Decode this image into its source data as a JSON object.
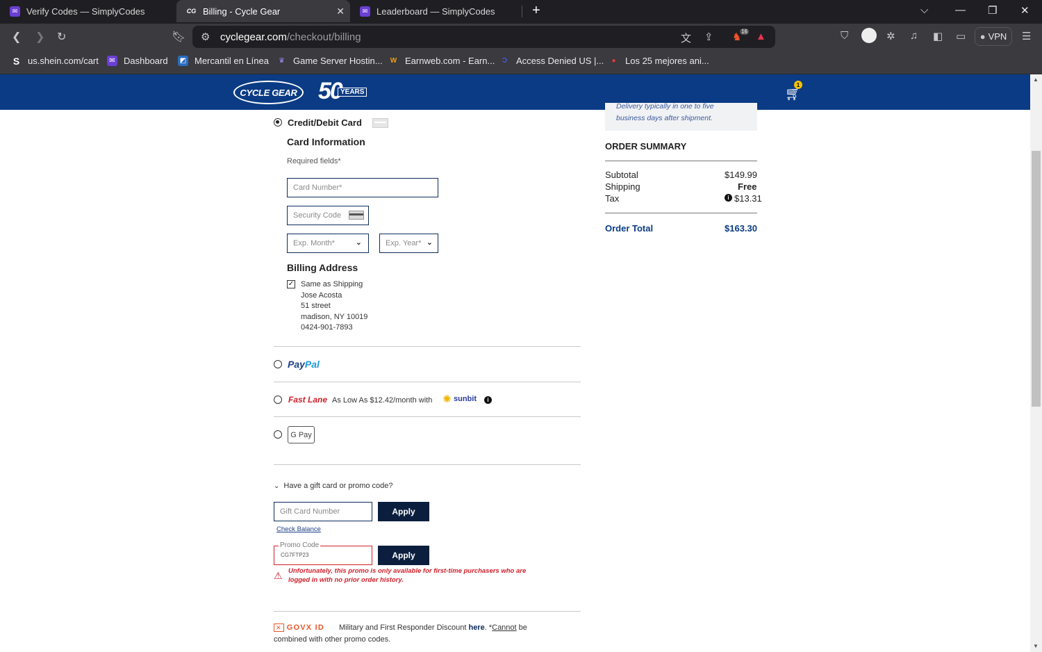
{
  "browser": {
    "tabs": [
      {
        "title": "Verify Codes — SimplyCodes",
        "favicon": "simplycodes-icon"
      },
      {
        "title": "Billing - Cycle Gear",
        "favicon": "CG"
      },
      {
        "title": "Leaderboard — SimplyCodes",
        "favicon": "simplycodes-icon"
      }
    ],
    "url_host": "cyclegear.com",
    "url_path": "/checkout/billing",
    "vpn_label": "VPN",
    "brave_badge": "16",
    "bookmarks": [
      {
        "label": "us.shein.com/cart",
        "icon": "S"
      },
      {
        "label": "Dashboard",
        "icon": "simplycodes-icon"
      },
      {
        "label": "Mercantil en Línea",
        "icon": "mercantil-icon"
      },
      {
        "label": "Game Server Hostin...",
        "icon": "game-server-icon"
      },
      {
        "label": "Earnweb.com - Earn...",
        "icon": "W"
      },
      {
        "label": "Access Denied US |...",
        "icon": "access-denied-icon"
      },
      {
        "label": "Los 25 mejores ani...",
        "icon": "pin-icon"
      }
    ]
  },
  "site": {
    "logo_text": "CYCLE GEAR",
    "anniversary_number": "50",
    "anniversary_word": "YEARS",
    "cart_count": "1"
  },
  "payment": {
    "credit_label": "Credit/Debit Card",
    "card_info_heading": "Card Information",
    "required_note": "Required fields*",
    "card_number_placeholder": "Card Number*",
    "security_code_placeholder": "Security Code",
    "exp_month_placeholder": "Exp. Month*",
    "exp_year_placeholder": "Exp. Year*",
    "billing_heading": "Billing Address",
    "same_as_shipping": "Same as Shipping",
    "address": {
      "name": "Jose Acosta",
      "street": "51 street",
      "city_line": "madison, NY 10019",
      "phone": "0424-901-7893"
    },
    "paypal_label": "PayPal",
    "fastlane_label": "Fast Lane",
    "fastlane_desc": "As Low As $12.42/month with",
    "sunbit_label": "sunbit",
    "gpay_label": "G Pay"
  },
  "promo": {
    "toggle_label": "Have a gift card or promo code?",
    "gift_placeholder": "Gift Card Number",
    "apply_label": "Apply",
    "check_balance": "Check Balance",
    "promo_label": "Promo Code",
    "promo_value": "CG7FTP23",
    "error_line1": "Unfortunately, this promo is only available for first-time purchasers who are",
    "error_line2": "logged in with no prior order history.",
    "govx_label": "GOVX ID",
    "govx_text_a": "Military and First Responder Discount",
    "govx_link": "here",
    "govx_text_b": ". *",
    "govx_cannot": "Cannot",
    "govx_text_c": "be",
    "govx_text_d": "combined with other promo codes."
  },
  "summary": {
    "delivery_note_partial": "Delivery typically in one to five",
    "delivery_note": "business days after shipment.",
    "heading": "ORDER SUMMARY",
    "subtotal_label": "Subtotal",
    "subtotal_value": "$149.99",
    "shipping_label": "Shipping",
    "shipping_value": "Free",
    "tax_label": "Tax",
    "tax_value": "$13.31",
    "total_label": "Order Total",
    "total_value": "$163.30"
  },
  "colors": {
    "brand_blue": "#0b3b84",
    "button_navy": "#0b1e3d",
    "error_red": "#d0202a",
    "summary_blue": "#0b3b84"
  }
}
